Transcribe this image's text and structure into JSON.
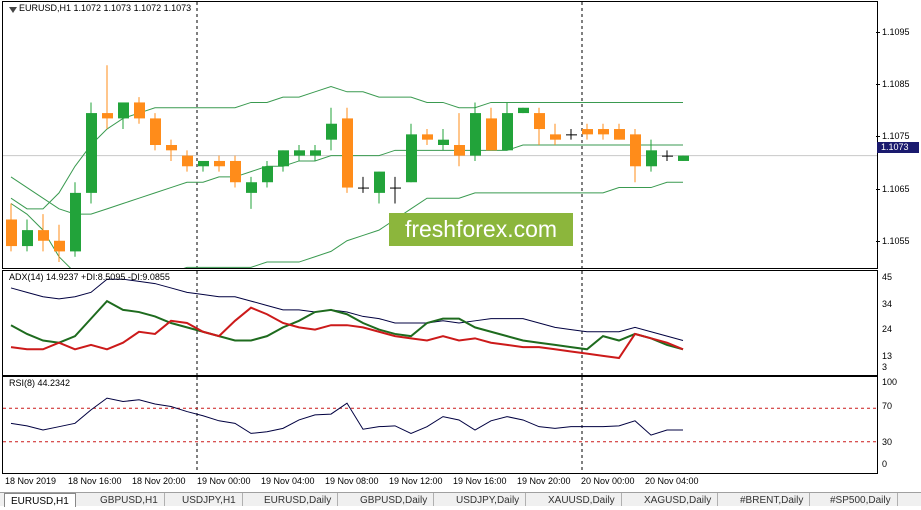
{
  "price_panel": {
    "title": "EURUSD,H1  1.1072 1.1073 1.1072 1.1073",
    "current_price": "1.1073",
    "axis_labels": [
      "1.1095",
      "1.1085",
      "1.1075",
      "1.1065",
      "1.1055"
    ],
    "watermark": "freshforex.com"
  },
  "adx_panel": {
    "title": "ADX(14) 14.9237 +DI:8.5095 -DI:9.0855",
    "axis_labels": [
      "45",
      "34",
      "24",
      "13",
      "3"
    ]
  },
  "rsi_panel": {
    "title": "RSI(8) 44.2342",
    "axis_labels": [
      "100",
      "70",
      "30",
      "0"
    ]
  },
  "time_axis": {
    "labels": [
      "18 Nov 2019",
      "18 Nov 16:00",
      "18 Nov 20:00",
      "19 Nov 00:00",
      "19 Nov 04:00",
      "19 Nov 08:00",
      "19 Nov 12:00",
      "19 Nov 16:00",
      "19 Nov 20:00",
      "20 Nov 00:00",
      "20 Nov 04:00"
    ]
  },
  "tabs": [
    "EURUSD,H1",
    "GBPUSD,H1",
    "USDJPY,H1",
    "EURUSD,Daily",
    "GBPUSD,Daily",
    "USDJPY,Daily",
    "XAUUSD,Daily",
    "XAGUSD,Daily",
    "#BRENT,Daily",
    "#SP500,Daily"
  ],
  "colors": {
    "bull": "#22a33a",
    "bear": "#ff8c1a",
    "bands": "#3a9a50",
    "adx_line": "#000040",
    "plus_di": "#1e6b1e",
    "minus_di": "#cc1a1a",
    "rsi_line": "#000040",
    "rsi_level": "#cc1a1a"
  },
  "chart_data": {
    "type": "candlestick",
    "symbol": "EURUSD",
    "timeframe": "H1",
    "candles": [
      {
        "o": 1.1061,
        "h": 1.1064,
        "l": 1.1055,
        "c": 1.1056
      },
      {
        "o": 1.1056,
        "h": 1.1061,
        "l": 1.1055,
        "c": 1.1059
      },
      {
        "o": 1.1059,
        "h": 1.1062,
        "l": 1.1055,
        "c": 1.1057
      },
      {
        "o": 1.1057,
        "h": 1.106,
        "l": 1.1053,
        "c": 1.1055
      },
      {
        "o": 1.1055,
        "h": 1.1068,
        "l": 1.1054,
        "c": 1.1066
      },
      {
        "o": 1.1066,
        "h": 1.1083,
        "l": 1.1064,
        "c": 1.1081
      },
      {
        "o": 1.1081,
        "h": 1.109,
        "l": 1.1078,
        "c": 1.108
      },
      {
        "o": 1.108,
        "h": 1.1083,
        "l": 1.1078,
        "c": 1.1083
      },
      {
        "o": 1.1083,
        "h": 1.1084,
        "l": 1.1079,
        "c": 1.108
      },
      {
        "o": 1.108,
        "h": 1.1081,
        "l": 1.1074,
        "c": 1.1075
      },
      {
        "o": 1.1075,
        "h": 1.1076,
        "l": 1.1072,
        "c": 1.1074
      },
      {
        "o": 1.1073,
        "h": 1.1074,
        "l": 1.107,
        "c": 1.1071
      },
      {
        "o": 1.1071,
        "h": 1.1072,
        "l": 1.107,
        "c": 1.1072
      },
      {
        "o": 1.1072,
        "h": 1.1073,
        "l": 1.107,
        "c": 1.1071
      },
      {
        "o": 1.1072,
        "h": 1.1073,
        "l": 1.1067,
        "c": 1.1068
      },
      {
        "o": 1.1066,
        "h": 1.1069,
        "l": 1.1063,
        "c": 1.1068
      },
      {
        "o": 1.1068,
        "h": 1.1072,
        "l": 1.1067,
        "c": 1.1071
      },
      {
        "o": 1.1071,
        "h": 1.1074,
        "l": 1.107,
        "c": 1.1074
      },
      {
        "o": 1.1073,
        "h": 1.1075,
        "l": 1.1072,
        "c": 1.1074
      },
      {
        "o": 1.1073,
        "h": 1.1075,
        "l": 1.1072,
        "c": 1.1074
      },
      {
        "o": 1.1076,
        "h": 1.1082,
        "l": 1.1074,
        "c": 1.1079
      },
      {
        "o": 1.108,
        "h": 1.1082,
        "l": 1.1066,
        "c": 1.1067
      },
      {
        "o": 1.1067,
        "h": 1.1069,
        "l": 1.1066,
        "c": 1.1067
      },
      {
        "o": 1.1066,
        "h": 1.107,
        "l": 1.1064,
        "c": 1.107
      },
      {
        "o": 1.1067,
        "h": 1.1069,
        "l": 1.1064,
        "c": 1.1067
      },
      {
        "o": 1.1068,
        "h": 1.1079,
        "l": 1.1068,
        "c": 1.1077
      },
      {
        "o": 1.1077,
        "h": 1.1078,
        "l": 1.1075,
        "c": 1.1076
      },
      {
        "o": 1.1075,
        "h": 1.1078,
        "l": 1.1074,
        "c": 1.1076
      },
      {
        "o": 1.1075,
        "h": 1.1081,
        "l": 1.1071,
        "c": 1.1073
      },
      {
        "o": 1.1073,
        "h": 1.1083,
        "l": 1.1072,
        "c": 1.1081
      },
      {
        "o": 1.108,
        "h": 1.1082,
        "l": 1.1074,
        "c": 1.1074
      },
      {
        "o": 1.1074,
        "h": 1.1083,
        "l": 1.1074,
        "c": 1.1081
      },
      {
        "o": 1.1081,
        "h": 1.1082,
        "l": 1.1081,
        "c": 1.1082
      },
      {
        "o": 1.1081,
        "h": 1.1082,
        "l": 1.1075,
        "c": 1.1078
      },
      {
        "o": 1.1077,
        "h": 1.1079,
        "l": 1.1075,
        "c": 1.1076
      },
      {
        "o": 1.1077,
        "h": 1.1078,
        "l": 1.1076,
        "c": 1.1077
      },
      {
        "o": 1.1078,
        "h": 1.1079,
        "l": 1.1076,
        "c": 1.1077
      },
      {
        "o": 1.1078,
        "h": 1.1079,
        "l": 1.1076,
        "c": 1.1077
      },
      {
        "o": 1.1078,
        "h": 1.1079,
        "l": 1.1076,
        "c": 1.1076
      },
      {
        "o": 1.1077,
        "h": 1.1078,
        "l": 1.1068,
        "c": 1.1071
      },
      {
        "o": 1.1071,
        "h": 1.1076,
        "l": 1.107,
        "c": 1.1074
      },
      {
        "o": 1.1073,
        "h": 1.1074,
        "l": 1.1072,
        "c": 1.1073
      },
      {
        "o": 1.1072,
        "h": 1.1073,
        "l": 1.1072,
        "c": 1.1073
      }
    ],
    "bollinger_upper": [
      1.1065,
      1.1063,
      1.1063,
      1.1066,
      1.1071,
      1.1075,
      1.1078,
      1.108,
      1.1081,
      1.1082,
      1.1082,
      1.1082,
      1.1082,
      1.1082,
      1.1082,
      1.1083,
      1.1083,
      1.1084,
      1.1084,
      1.1085,
      1.1086,
      1.1085,
      1.1085,
      1.1084,
      1.1084,
      1.1084,
      1.1083,
      1.1083,
      1.1082,
      1.1082,
      1.1083,
      1.1083,
      1.1083,
      1.1083,
      1.1083,
      1.1083,
      1.1083,
      1.1083,
      1.1083,
      1.1083,
      1.1083,
      1.1083,
      1.1083
    ],
    "bollinger_middle": [
      1.1069,
      1.1067,
      1.1065,
      1.1063,
      1.1062,
      1.1062,
      1.1063,
      1.1064,
      1.1065,
      1.1066,
      1.1067,
      1.1068,
      1.1068,
      1.1069,
      1.1069,
      1.107,
      1.1071,
      1.1071,
      1.1072,
      1.1072,
      1.1073,
      1.1073,
      1.1073,
      1.1073,
      1.1074,
      1.1074,
      1.1074,
      1.1074,
      1.1074,
      1.1074,
      1.1074,
      1.1074,
      1.1075,
      1.1075,
      1.1075,
      1.1075,
      1.1075,
      1.1075,
      1.1075,
      1.1075,
      1.1075,
      1.1075,
      1.1075
    ],
    "bollinger_lower": [
      1.1064,
      1.1062,
      1.1059,
      1.1054,
      1.1051,
      1.1049,
      1.1048,
      1.1048,
      1.1049,
      1.105,
      1.1051,
      1.1052,
      1.1052,
      1.1052,
      1.1052,
      1.1052,
      1.1053,
      1.1053,
      1.1053,
      1.1054,
      1.1055,
      1.1057,
      1.1058,
      1.1059,
      1.1061,
      1.1063,
      1.1065,
      1.1065,
      1.1065,
      1.1066,
      1.1066,
      1.1066,
      1.1066,
      1.1066,
      1.1066,
      1.1066,
      1.1066,
      1.1066,
      1.1067,
      1.1067,
      1.1067,
      1.1068,
      1.1068
    ],
    "adx": [
      40,
      38,
      36,
      35,
      36,
      38,
      44,
      44,
      43,
      42,
      40,
      38,
      37,
      36,
      36,
      34,
      32,
      30,
      30,
      29,
      30,
      29,
      27,
      26,
      24,
      24,
      24,
      25,
      24,
      25,
      26,
      26,
      26,
      24,
      22,
      21,
      20,
      20,
      20,
      22,
      20,
      18,
      16
    ],
    "plus_di": [
      23,
      19,
      16,
      15,
      18,
      26,
      34,
      30,
      29,
      27,
      24,
      22,
      20,
      18,
      16,
      16,
      18,
      22,
      25,
      29,
      30,
      28,
      24,
      21,
      19,
      18,
      24,
      26,
      26,
      22,
      20,
      18,
      16,
      15,
      14,
      13,
      12,
      18,
      16,
      19,
      17,
      14,
      12
    ],
    "minus_di": [
      13,
      12,
      12,
      15,
      12,
      14,
      12,
      15,
      20,
      19,
      25,
      24,
      20,
      18,
      25,
      31,
      28,
      24,
      22,
      21,
      23,
      23,
      22,
      20,
      18,
      17,
      16,
      18,
      16,
      17,
      15,
      14,
      13,
      13,
      12,
      11,
      10,
      9,
      8,
      19,
      17,
      15,
      12
    ],
    "rsi": [
      52,
      49,
      44,
      48,
      52,
      68,
      82,
      78,
      80,
      75,
      72,
      66,
      61,
      55,
      52,
      40,
      42,
      46,
      56,
      62,
      63,
      76,
      45,
      48,
      49,
      40,
      48,
      60,
      56,
      44,
      55,
      60,
      56,
      48,
      46,
      48,
      48,
      48,
      49,
      55,
      38,
      44,
      44
    ],
    "rsi_levels": [
      70,
      30
    ],
    "price_range": [
      1.105,
      1.11
    ],
    "adx_range": [
      3,
      45
    ],
    "rsi_range": [
      0,
      100
    ],
    "grid": false
  }
}
